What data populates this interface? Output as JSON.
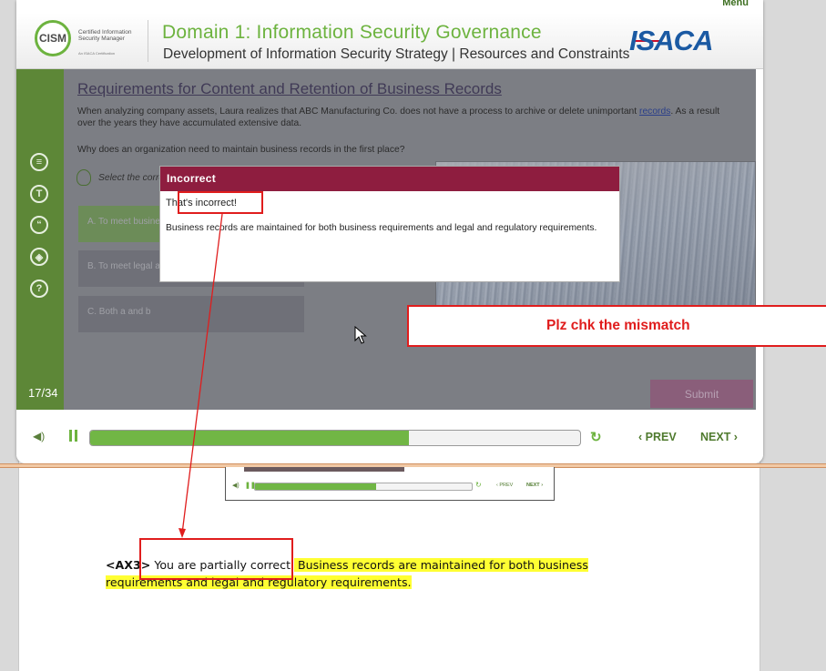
{
  "player": {
    "menu_label": "Menu",
    "header": {
      "logo_text": "CISM",
      "cert_line1": "Certified Information",
      "cert_line2": "Security Manager",
      "cert_sub": "An ISACA Certification",
      "domain_title": "Domain 1: Information Security Governance",
      "domain_subtitle": "Development of Information Security Strategy | Resources and Constraints",
      "brand": "ISACA"
    },
    "sidebar": {
      "icons": [
        "notes-icon",
        "transcript-icon",
        "quote-icon",
        "layers-icon",
        "help-icon"
      ],
      "icon_glyphs": [
        "≡",
        "T",
        "“",
        "◈",
        "?"
      ],
      "slide_counter": "17/34"
    },
    "content": {
      "title": "Requirements for Content and Retention of Business Records",
      "body_before_link": "When analyzing company assets, Laura realizes that ABC Manufacturing Co. does not have a process to archive or delete unimportant ",
      "body_link": "records",
      "body_after_link": ". As a result over the years they have accumulated extensive data.",
      "question": "Why does an organization need to maintain business records in the first place?",
      "instruction": "Select the correct answer and click Submit.",
      "options": [
        "A.   To meet business requirements",
        "B.   To meet legal and regulatory requirements",
        "C.   Both a and b"
      ],
      "submit_label": "Submit"
    },
    "dialog": {
      "title": "Incorrect",
      "line1": "That's incorrect!",
      "line2": "Business records are maintained for both business requirements and legal and regulatory requirements."
    },
    "controls": {
      "progress_fraction": 0.65,
      "prev_label": "‹  PREV",
      "next_label": "NEXT  ›"
    }
  },
  "thumbnail": {
    "progress_fraction": 0.56,
    "prev_label": "‹ PREV",
    "next_label": "NEXT ›"
  },
  "document": {
    "tag": "<AX3>",
    "text_plain": " You are partially correct.",
    "text_highlighted": " Business records are maintained for both business requirements and legal and regulatory requirements."
  },
  "annotations": {
    "comment": "Plz chk the mismatch",
    "color": "#e01d1d"
  },
  "colors": {
    "brand_green": "#6db33f",
    "dialog_header": "#8e1d3f",
    "highlight": "#ffff33"
  }
}
